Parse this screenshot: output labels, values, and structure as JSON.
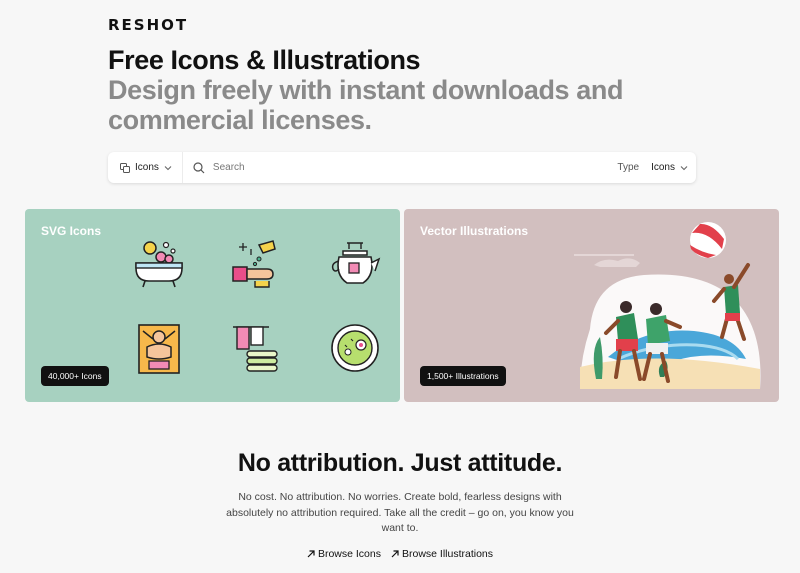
{
  "brand": {
    "logo": "RESHOT"
  },
  "hero": {
    "title": "Free Icons & Illustrations",
    "subtitle": "Design freely with instant downloads and commercial licenses."
  },
  "search": {
    "category_value": "Icons",
    "placeholder": "Search",
    "type_label": "Type",
    "type_value": "Icons"
  },
  "cards": {
    "svg": {
      "title": "SVG Icons",
      "badge": "40,000+ Icons",
      "bg": "#a7d1c0"
    },
    "vector": {
      "title": "Vector Illustrations",
      "badge": "1,500+ Illustrations",
      "bg": "#d2bfbf"
    }
  },
  "section": {
    "heading": "No attribution. Just attitude.",
    "text": "No cost. No attribution. No worries. Create bold, fearless designs with absolutely no attribution required. Take all the credit – go on, you know you want to.",
    "link_icons": "Browse Icons",
    "link_illustrations": "Browse Illustrations"
  }
}
